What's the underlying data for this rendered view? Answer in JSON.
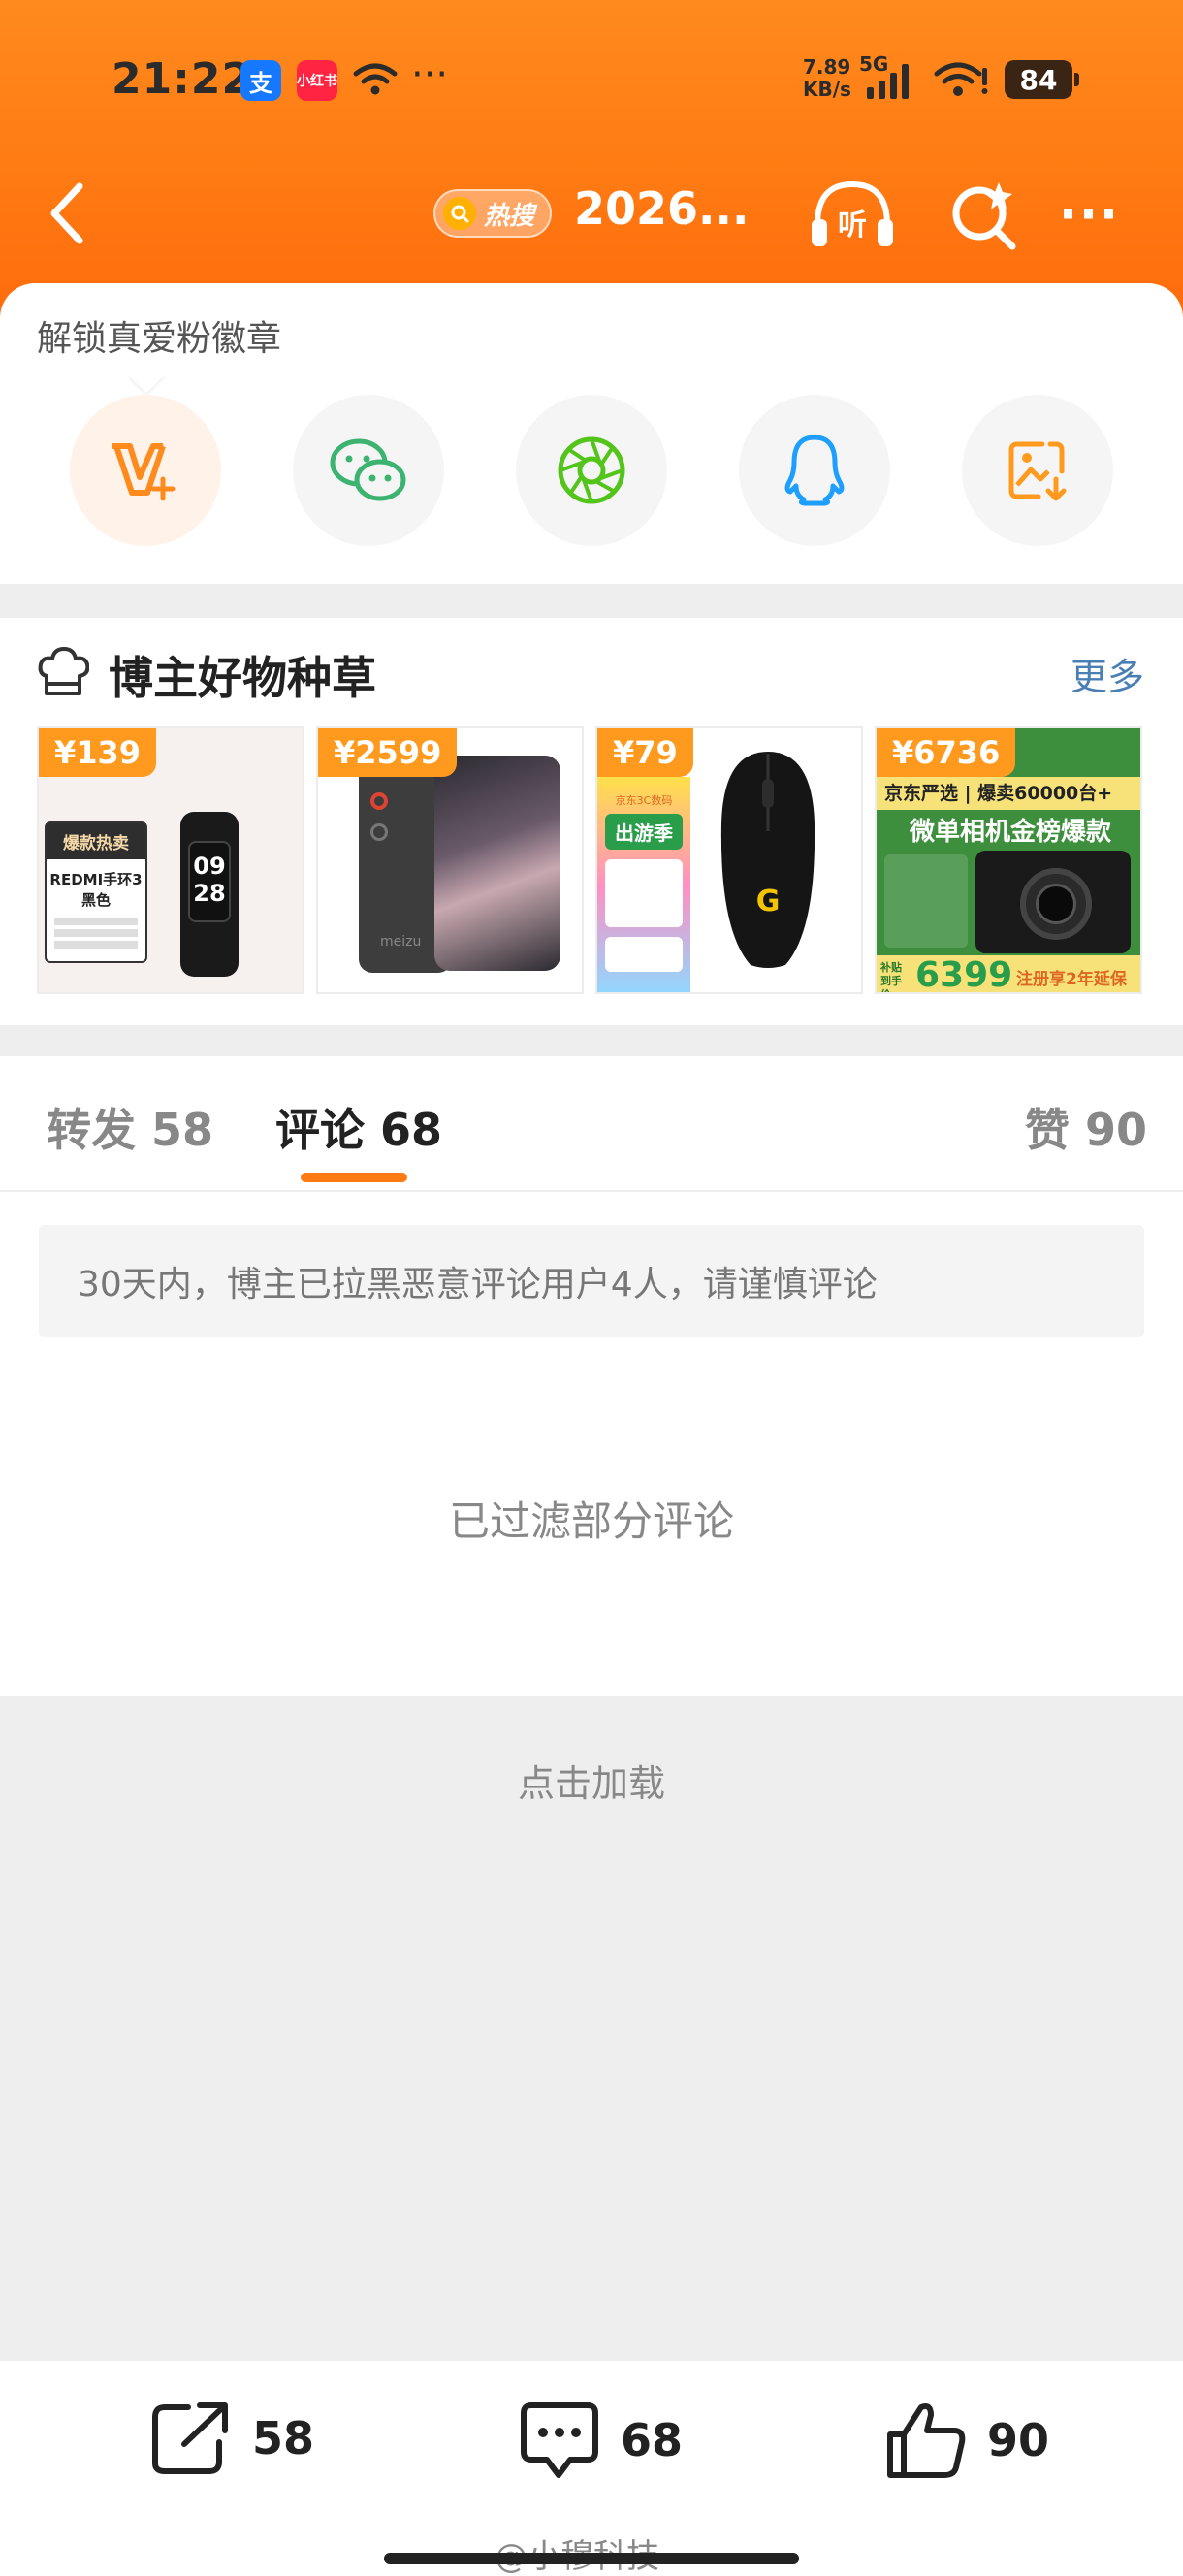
{
  "status_bar": {
    "time": "21:22",
    "app_alipay": "支",
    "app_xhs": "小红书",
    "overflow": "···",
    "speed_value": "7.89",
    "speed_unit": "KB/s",
    "network": "5G",
    "battery": "84"
  },
  "nav": {
    "hot_label": "热搜",
    "title": "2026...",
    "listen_label": "听",
    "more": "···"
  },
  "share": {
    "badge_title": "解锁真爱粉徽章",
    "buttons": [
      "vip-badge",
      "wechat",
      "moments",
      "qq",
      "save-image"
    ]
  },
  "goods": {
    "title": "博主好物种草",
    "more": "更多",
    "products": [
      {
        "price": "¥139",
        "tag": "爆款热卖",
        "name": "REDMI手环3",
        "color": "黑色",
        "screen_time_hh": "09",
        "screen_time_mm": "28"
      },
      {
        "price": "¥2599",
        "brand": "meizu"
      },
      {
        "price": "¥79",
        "banner": "出游季",
        "shop": "京东3C数码"
      },
      {
        "price": "¥6736",
        "line1": "京东严选 | 爆卖60000台+",
        "line2": "微单相机金榜爆款",
        "promo_price": "6399",
        "promo_label": "补贴 到手价",
        "service": "注册享2年延保"
      }
    ]
  },
  "tabs": {
    "repost": "转发 58",
    "comment": "评论 68",
    "like": "赞 90"
  },
  "notice": "30天内，博主已拉黑恶意评论用户4人，请谨慎评论",
  "filtered": "已过滤部分评论",
  "load_more": "点击加载",
  "bottom": {
    "repost_count": "58",
    "comment_count": "68",
    "like_count": "90",
    "watermark": "@小穆科技"
  }
}
